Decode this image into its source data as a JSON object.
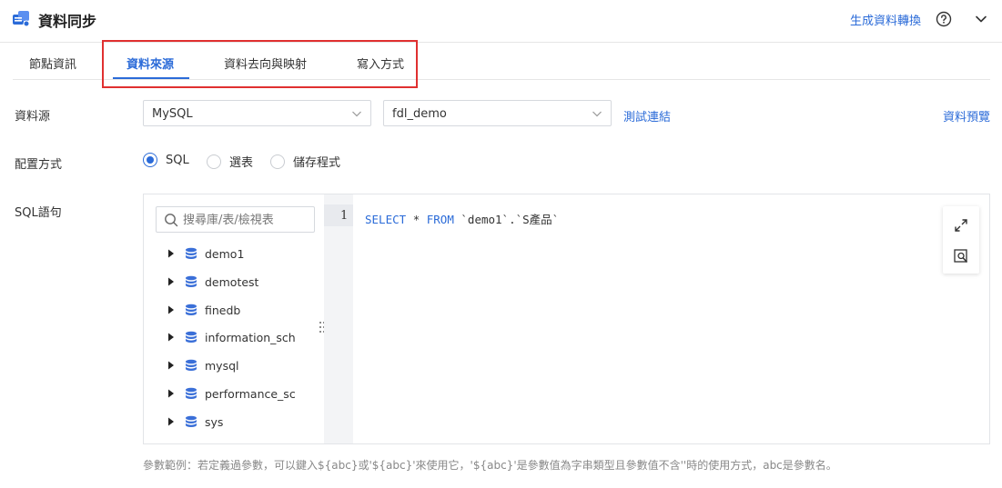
{
  "header": {
    "title": "資料同步",
    "generate_link": "生成資料轉換"
  },
  "tabs": [
    {
      "label": "節點資訊"
    },
    {
      "label": "資料來源"
    },
    {
      "label": "資料去向與映射"
    },
    {
      "label": "寫入方式"
    }
  ],
  "active_tab": "資料來源",
  "form": {
    "source_label": "資料源",
    "source_type": "MySQL",
    "connection": "fdl_demo",
    "test_link": "測試連結",
    "preview_link": "資料預覽",
    "config_label": "配置方式",
    "config_options": [
      {
        "label": "SQL",
        "selected": true
      },
      {
        "label": "選表",
        "selected": false
      },
      {
        "label": "儲存程式",
        "selected": false
      }
    ],
    "sql_label": "SQL語句"
  },
  "tree": {
    "search_placeholder": "搜尋庫/表/檢視表",
    "items": [
      {
        "label": "demo1"
      },
      {
        "label": "demotest"
      },
      {
        "label": "finedb"
      },
      {
        "label": "information_schema"
      },
      {
        "label": "mysql"
      },
      {
        "label": "performance_schema"
      },
      {
        "label": "sys"
      }
    ]
  },
  "editor": {
    "line_number": "1",
    "code": {
      "kw_select": "SELECT",
      "star": "*",
      "kw_from": "FROM",
      "table": "`demo1`.`S產品`"
    }
  },
  "hint": "參數範例：若定義過參數，可以鍵入${abc}或'${abc}'來使用它，'${abc}'是參數值為字串類型且參數值不含''時的使用方式，abc是參數名。",
  "colors": {
    "accent": "#2b6bd8",
    "highlight_border": "#e03030"
  }
}
